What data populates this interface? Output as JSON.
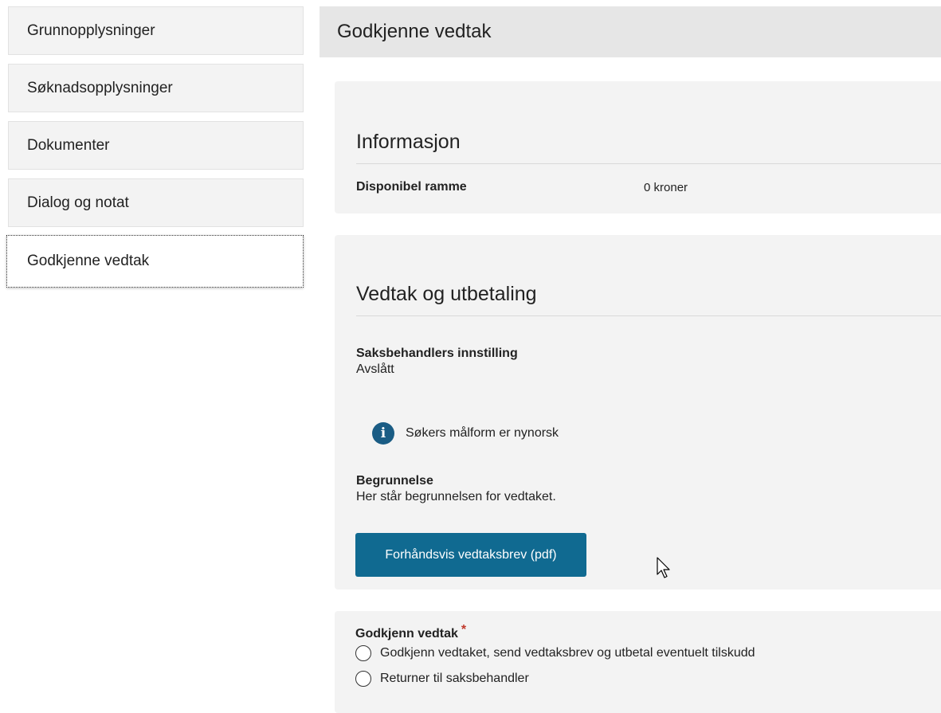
{
  "sidebar": {
    "items": [
      {
        "label": "Grunnopplysninger"
      },
      {
        "label": "Søknadsopplysninger"
      },
      {
        "label": "Dokumenter"
      },
      {
        "label": "Dialog og notat"
      },
      {
        "label": "Godkjenne vedtak",
        "active": true
      }
    ]
  },
  "header": {
    "title": "Godkjenne vedtak"
  },
  "informasjon": {
    "title": "Informasjon",
    "disponibel_label": "Disponibel ramme",
    "disponibel_value": "0 kroner"
  },
  "vedtak": {
    "title": "Vedtak og utbetaling",
    "innstilling_label": "Saksbehandlers innstilling",
    "innstilling_value": "Avslått",
    "notice": "Søkers målform er nynorsk",
    "notice_icon": "info-icon",
    "begrunnelse_label": "Begrunnelse",
    "begrunnelse_value": "Her står begrunnelsen for vedtaket.",
    "pdf_button": "Forhåndsvis vedtaksbrev (pdf)"
  },
  "godkjenn": {
    "label": "Godkjenn vedtak",
    "required_mark": "*",
    "options": [
      {
        "label": "Godkjenn vedtaket, send vedtaksbrev og utbetal eventuelt tilskudd",
        "selected": false
      },
      {
        "label": "Returner til saksbehandler",
        "selected": false
      }
    ]
  },
  "colors": {
    "accent": "#106a91",
    "info_icon": "#1a5c84",
    "required": "#c0392b",
    "panel_bg": "#f3f3f3",
    "header_bg": "#e6e6e6"
  }
}
